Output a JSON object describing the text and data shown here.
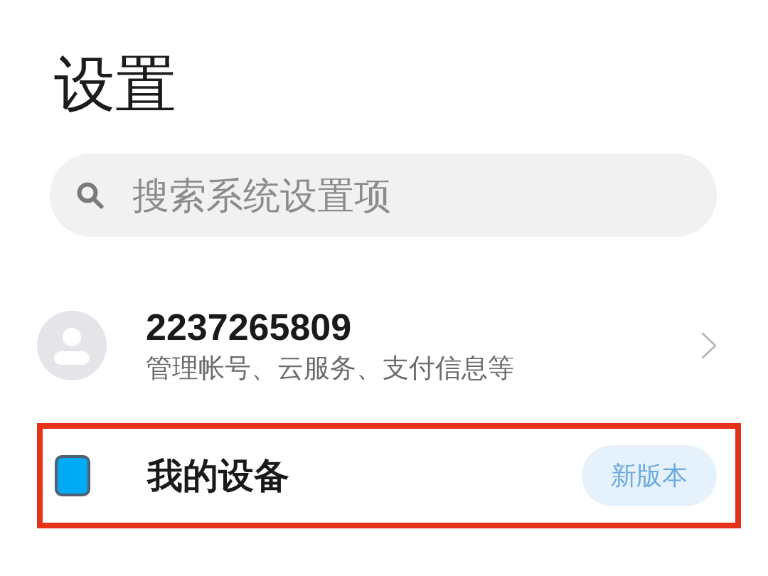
{
  "header": {
    "title": "设置"
  },
  "search": {
    "placeholder": "搜索系统设置项"
  },
  "items": [
    {
      "kind": "account",
      "title": "2237265809",
      "subtitle": "管理帐号、云服务、支付信息等",
      "highlighted": false
    },
    {
      "kind": "device",
      "title": "我的设备",
      "badge": "新版本",
      "highlighted": true
    }
  ]
}
